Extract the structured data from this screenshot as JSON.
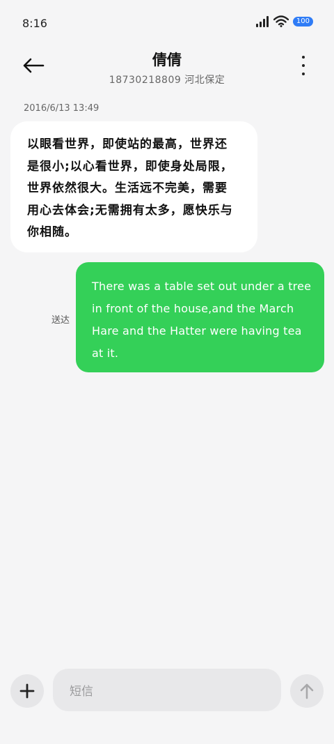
{
  "status_bar": {
    "time": "8:16",
    "battery": "100",
    "icons": [
      "signal-icon",
      "wifi-icon",
      "battery-icon"
    ]
  },
  "header": {
    "contact_name": "倩倩",
    "contact_detail": "18730218809 河北保定",
    "icons": [
      "back-arrow-icon",
      "more-vertical-icon"
    ]
  },
  "conversation": {
    "timestamp": "2016/6/13 13:49",
    "incoming": {
      "text": "以眼看世界，即使站的最高，世界还是很小;以心看世界，即使身处局限，世界依然很大。生活远不完美，需要用心去体会;无需拥有太多，愿快乐与你相随。"
    },
    "outgoing": {
      "text": "There was a table set out under a tree in front of the house,and the March Hare and the Hatter were having tea at it.",
      "status": "送达",
      "color": "#34d058"
    }
  },
  "composer": {
    "placeholder": "短信",
    "icons": [
      "plus-icon",
      "send-arrow-up-icon"
    ]
  }
}
